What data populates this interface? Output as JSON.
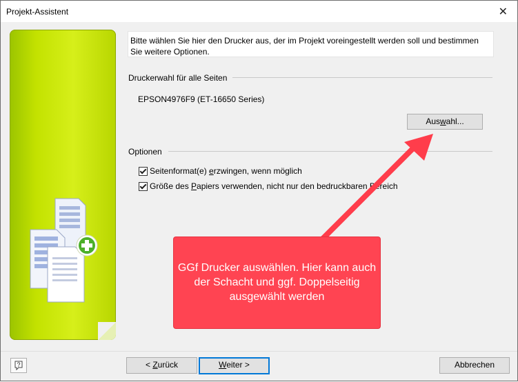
{
  "window": {
    "title": "Projekt-Assistent",
    "close_glyph": "✕"
  },
  "instruction": "Bitte wählen Sie hier den Drucker aus, der im Projekt voreingestellt werden soll und bestimmen Sie weitere Optionen.",
  "printer_group": {
    "label": "Druckerwahl für alle Seiten",
    "printer_name": "EPSON4976F9 (ET-16650 Series)",
    "select_button": {
      "pre": "Aus",
      "key": "w",
      "post": "ahl..."
    }
  },
  "options_group": {
    "label": "Optionen",
    "items": [
      {
        "pre": "Seitenformat(e) ",
        "key": "e",
        "post": "rzwingen, wenn möglich",
        "checked": true
      },
      {
        "pre": "Größe des ",
        "key": "P",
        "post": "apiers verwenden, nicht nur den bedruckbaren Bereich",
        "checked": true
      }
    ]
  },
  "annotation": "GGf Drucker auswählen. Hier kann auch der Schacht und ggf. Doppelseitig ausgewählt werden",
  "buttons": {
    "back": {
      "pre": "< ",
      "key": "Z",
      "post": "urück"
    },
    "next": {
      "pre": "",
      "key": "W",
      "post": "eiter >"
    },
    "cancel": "Abbrechen",
    "help_glyph": "?"
  },
  "icons": [
    "close-icon",
    "document-add-icon",
    "help-icon",
    "arrow-icon"
  ],
  "colors": {
    "accent_green": "#c3e200",
    "callout_red": "#ff4452",
    "focus_blue": "#0078d7"
  }
}
